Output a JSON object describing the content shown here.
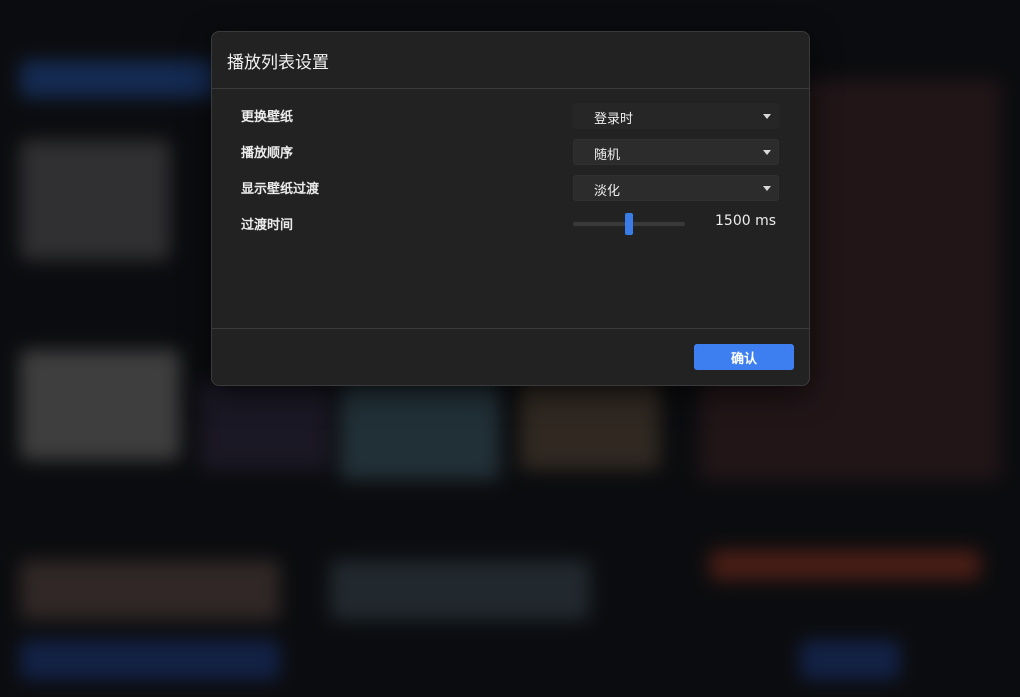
{
  "dialog": {
    "title": "播放列表设置",
    "rows": [
      {
        "label": "更换壁纸",
        "value": "登录时"
      },
      {
        "label": "播放顺序",
        "value": "随机"
      },
      {
        "label": "显示壁纸过渡",
        "value": "淡化"
      },
      {
        "label": "过渡时间"
      }
    ],
    "transition": {
      "value_text": "1500 ms",
      "level": 0.5
    },
    "confirm_label": "确认"
  },
  "colors": {
    "accent": "#3d7ff0",
    "dialog_bg": "#222222"
  }
}
